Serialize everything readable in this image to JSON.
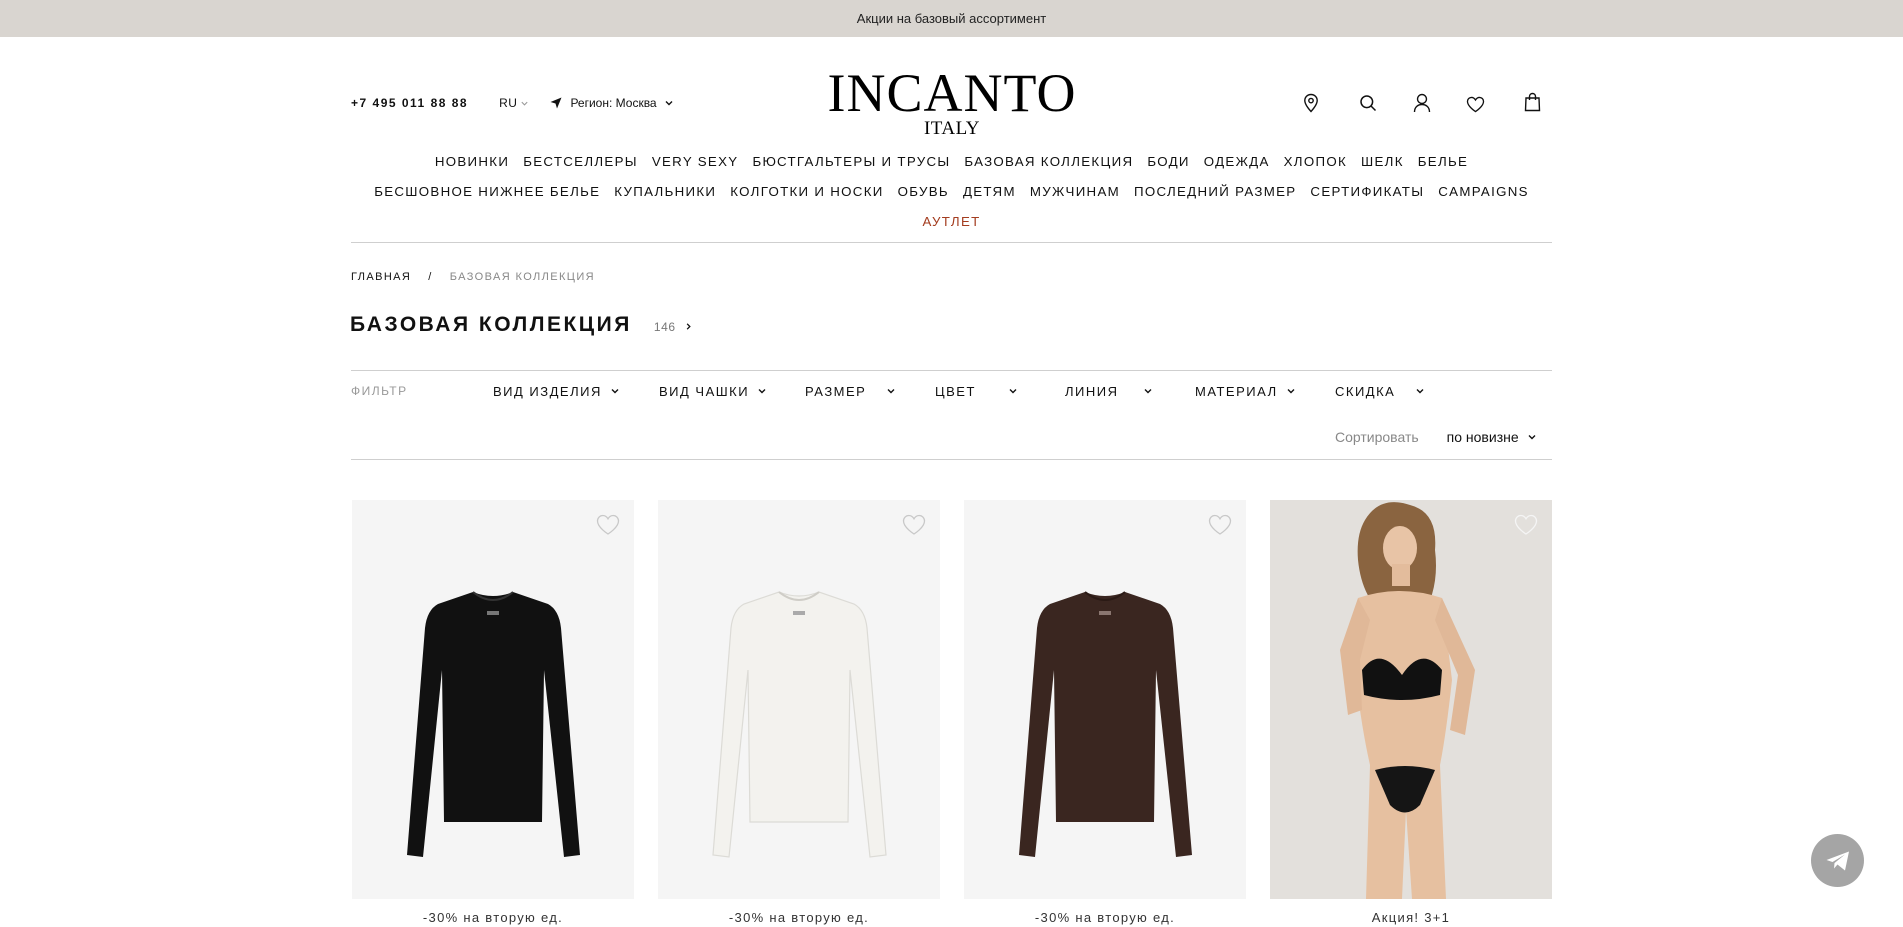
{
  "promo_bar": {
    "text": "Акции на базовый ассортимент"
  },
  "header": {
    "phone": "+7 495 011 88 88",
    "language": "RU",
    "region": "Регион: Москва",
    "logo_main": "INCANTO",
    "logo_sub": "ITALY",
    "icons": [
      "location-pin-icon",
      "search-icon",
      "account-icon",
      "heart-icon",
      "shopping-bag-icon"
    ]
  },
  "nav": {
    "row1": [
      "НОВИНКИ",
      "БЕСТСЕЛЛЕРЫ",
      "VERY SEXY",
      "БЮСТГАЛЬТЕРЫ И ТРУСЫ",
      "БАЗОВАЯ КОЛЛЕКЦИЯ",
      "БОДИ",
      "ОДЕЖДА",
      "ХЛОПОК",
      "ШЕЛК",
      "БЕЛЬЕ"
    ],
    "row2": [
      "БЕСШОВНОЕ НИЖНЕЕ БЕЛЬЕ",
      "КУПАЛЬНИКИ",
      "КОЛГОТКИ И НОСКИ",
      "ОБУВЬ",
      "ДЕТЯМ",
      "МУЖЧИНАМ",
      "ПОСЛЕДНИЙ РАЗМЕР",
      "СЕРТИФИКАТЫ",
      "CAMPAIGNS"
    ],
    "outlet": "АУТЛЕТ",
    "outlet_color": "#a33c1f"
  },
  "breadcrumb": {
    "home": "ГЛАВНАЯ",
    "separator": "/",
    "current": "БАЗОВАЯ КОЛЛЕКЦИЯ"
  },
  "page": {
    "title": "БАЗОВАЯ КОЛЛЕКЦИЯ",
    "count": "146"
  },
  "filters": {
    "label": "ФИЛЬТР",
    "items": [
      "ВИД ИЗДЕЛИЯ",
      "ВИД ЧАШКИ",
      "РАЗМЕР",
      "ЦВЕТ",
      "ЛИНИЯ",
      "МАТЕРИАЛ",
      "СКИДКА"
    ]
  },
  "sort": {
    "label": "Сортировать",
    "value": "по новизне"
  },
  "products": [
    {
      "promo": "-30% на вторую ед.",
      "image": "black long-sleeve top",
      "color": "#111111"
    },
    {
      "promo": "-30% на вторую ед.",
      "image": "white long-sleeve top",
      "color": "#f2f1ec"
    },
    {
      "promo": "-30% на вторую ед.",
      "image": "brown long-sleeve top",
      "color": "#3a2620"
    },
    {
      "promo": "Акция! 3+1",
      "image": "model in black lace lingerie set",
      "color": "#111111"
    }
  ],
  "telegram_button": {
    "icon": "telegram-icon"
  }
}
